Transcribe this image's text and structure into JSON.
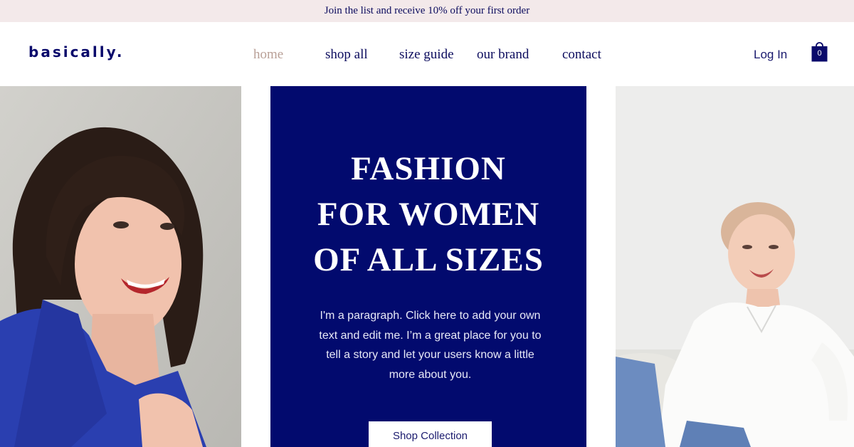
{
  "announcement": {
    "text": "Join the list and receive 10% off your first order"
  },
  "header": {
    "logo": "basically.",
    "nav": [
      {
        "label": "home",
        "active": true
      },
      {
        "label": "shop all",
        "active": false
      },
      {
        "label": "size guide",
        "active": false
      },
      {
        "label": "our brand",
        "active": false
      },
      {
        "label": "contact",
        "active": false
      }
    ],
    "login_label": "Log In",
    "cart_count": "0"
  },
  "hero": {
    "title_lines": [
      "FASHION",
      "FOR WOMEN",
      "OF ALL SIZES"
    ],
    "paragraph": "I'm a paragraph. Click here to add your own text and edit me. I’m a great place for you to tell a story and let your users know a little more about you.",
    "button_label": "Shop Collection"
  },
  "colors": {
    "brand_navy": "#020a6e",
    "announcement_bg": "#f3e9ea",
    "nav_active": "#b9a097",
    "text_navy": "#0c0c5e"
  },
  "icons": {
    "cart": "shopping-bag-icon"
  }
}
